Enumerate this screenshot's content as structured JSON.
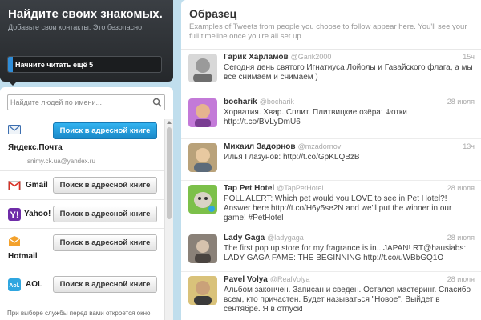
{
  "left": {
    "title": "Найдите своих знакомых.",
    "subtitle": "Добавьте свои контакты. Это безопасно.",
    "progress_label": "Начните читать ещё 5",
    "progress_fraction": 0.03,
    "search_placeholder": "Найдите людей по имени...",
    "services": [
      {
        "name": "Яндекс.Почта",
        "email": "snimy.ck.ua@yandex.ru",
        "button": "Поиск в адресной книге",
        "icon": "envelope-icon",
        "primary": true
      },
      {
        "name": "Gmail",
        "button": "Поиск в адресной книге",
        "icon": "gmail-icon"
      },
      {
        "name": "Yahoo!",
        "button": "Поиск в адресной книге",
        "icon": "yahoo-icon"
      },
      {
        "name": "Hotmail",
        "button": "Поиск в адресной книге",
        "icon": "hotmail-icon"
      },
      {
        "name": "AOL",
        "button": "Поиск в адресной книге",
        "icon": "aol-icon"
      }
    ],
    "footnote": "При выборе службы перед вами откроется окно"
  },
  "right": {
    "title": "Образец",
    "description": "Examples of Tweets from people you choose to follow appear here. You'll see your full timeline once you're all set up.",
    "tweets": [
      {
        "name": "Гарик Харламов",
        "handle": "@Garik2000",
        "time": "15ч",
        "text": "Сегодня день святого Игнатиуса Лойолы и Гавайского флага, а мы все снимаем и снимаем )"
      },
      {
        "name": "bocharik",
        "handle": "@bocharik",
        "time": "28 июля",
        "text": "Хорватия. Хвар. Сплит. Плитвицкие озёра: Фотки http://t.co/BVLyDmU6"
      },
      {
        "name": "Михаил Задорнов",
        "handle": "@mzadornov",
        "time": "13ч",
        "text": "Илья Глазунов: http://t.co/GpKLQBzB"
      },
      {
        "name": "Tap Pet Hotel",
        "handle": "@TapPetHotel",
        "time": "28 июля",
        "text": "POLL ALERT: Which pet would you LOVE to see in Pet Hotel?! Answer here http://t.co/H6y5se2N and we'll put the winner in our game! #PetHotel"
      },
      {
        "name": "Lady Gaga",
        "handle": "@ladygaga",
        "time": "28 июля",
        "text": "The first pop up store for my fragrance is in...JAPAN! RT@hausiabs: LADY GAGA FAME: THE BEGINNING http://t.co/uWBbGQ1O"
      },
      {
        "name": "Pavel Volya",
        "handle": "@RealVolya",
        "time": "28 июля",
        "text": "Альбом закончен. Записан и сведен. Остался мастеринг. Спасибо всем, кто причастен. Будет называться \"Новое\". Выйдет в сентябре. Я в отпуск!"
      }
    ]
  },
  "colors": {
    "accent": "#2f8dd8",
    "background": "#c0deed",
    "dark_header": "#25282b"
  }
}
